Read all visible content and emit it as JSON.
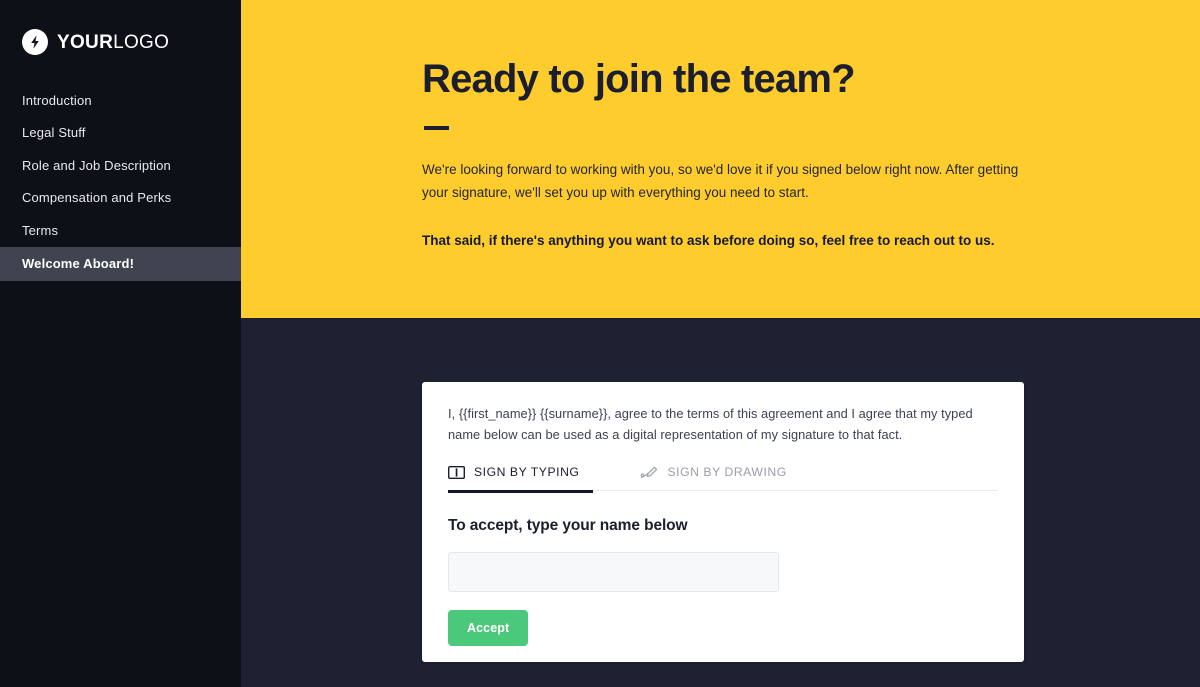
{
  "sidebar": {
    "logo": {
      "icon": "lightning-bolt-icon",
      "text_bold": "YOUR",
      "text_light": "LOGO"
    },
    "items": [
      {
        "label": "Introduction",
        "active": false
      },
      {
        "label": "Legal Stuff",
        "active": false
      },
      {
        "label": "Role and Job Description",
        "active": false
      },
      {
        "label": "Compensation and Perks",
        "active": false
      },
      {
        "label": "Terms",
        "active": false
      },
      {
        "label": "Welcome Aboard!",
        "active": true
      }
    ]
  },
  "hero": {
    "title": "Ready to join the team?",
    "paragraph": "We're looking forward to working with you, so we'd love it if you signed below right now. After getting your signature, we'll set you up with everything you need to start.",
    "bold_paragraph": "That said, if there's anything you want to ask before doing so, feel free to reach out to us.",
    "background_color": "#ffcc2e"
  },
  "card": {
    "agreement_text": "I, {{first_name}} {{surname}}, agree to the terms of this agreement and I agree that my typed name below can be used as a digital representation of my signature to that fact.",
    "tabs": [
      {
        "label": "SIGN BY TYPING",
        "icon": "keyboard-typing-icon",
        "active": true
      },
      {
        "label": "SIGN BY DRAWING",
        "icon": "pen-signature-icon",
        "active": false
      }
    ],
    "accept_heading": "To accept, type your name below",
    "name_input": {
      "value": "",
      "placeholder": ""
    },
    "accept_button": {
      "label": "Accept",
      "color": "#4bc97a"
    }
  },
  "colors": {
    "sidebar_bg": "#0e1018",
    "page_bg": "#1e2131",
    "accent_yellow": "#ffcc2e",
    "active_nav_bg": "#3f4450",
    "dark_text": "#1b1e2c",
    "success_green": "#4bc97a"
  }
}
